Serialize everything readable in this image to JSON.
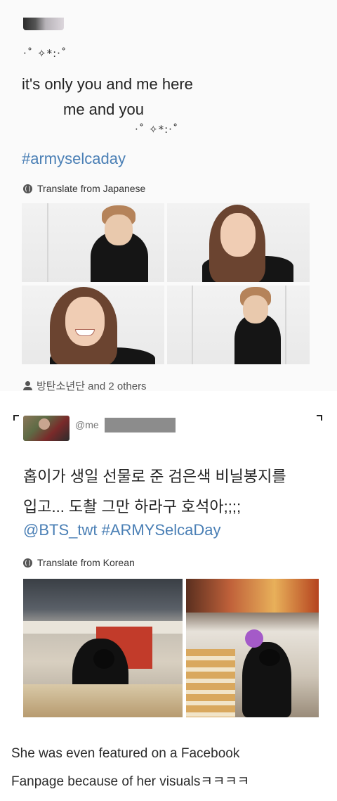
{
  "tweet1": {
    "sparkle_top": "·˚ ✧*:·˚",
    "line1": "it's only you and me here",
    "line2": "me and you",
    "sparkle_bottom": "·˚ ✧*:·˚",
    "hashtag": "#armyselcaday",
    "translate": "Translate from Japanese",
    "likes": "방탄소년단 and 2 others"
  },
  "tweet2": {
    "handle": "@me",
    "line1": "홉이가 생일 선물로 준 검은색 비닐봉지를",
    "line2": "입고... 도촬 그만 하라구 호석아;;;;",
    "links": "@BTS_twt #ARMYSelcaDay",
    "translate": "Translate from Korean"
  },
  "caption": {
    "line1": "She was even featured on a Facebook",
    "line2": "Fanpage because of her visualsㅋㅋㅋㅋ"
  },
  "icons": [
    "globe-icon",
    "person-icon"
  ],
  "colors": {
    "link": "#4a7fb5",
    "text": "#222222",
    "muted": "#777777"
  }
}
